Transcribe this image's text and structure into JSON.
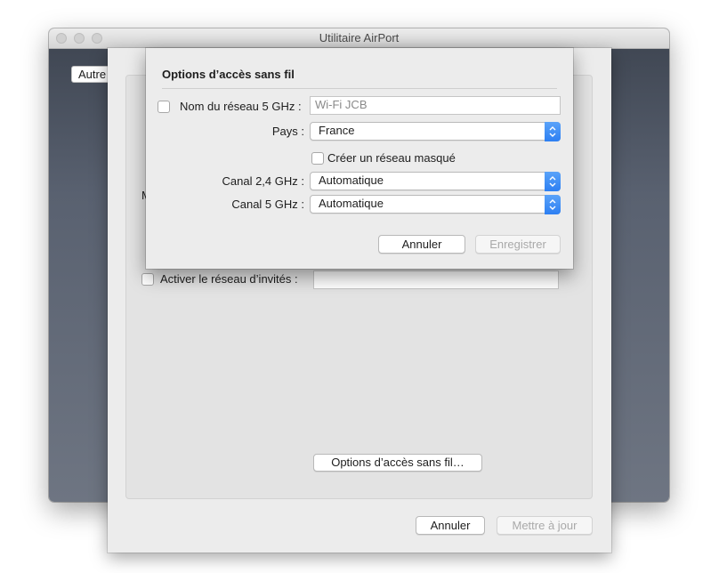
{
  "window": {
    "title": "Utilitaire AirPort",
    "autre_button": "Autre"
  },
  "main_sheet": {
    "partial_label": "M",
    "guest_network_label": "Activer le réseau d’invités :",
    "guest_network_value": "",
    "wireless_options_button": "Options d’accès sans fil…",
    "cancel_button": "Annuler",
    "update_button": "Mettre à jour"
  },
  "options_sheet": {
    "title": "Options d’accès sans fil",
    "network5_label": "Nom du réseau 5 GHz :",
    "network5_value": "Wi-Fi JCB",
    "country_label": "Pays :",
    "country_value": "France",
    "hidden_network_label": "Créer un réseau masqué",
    "channel24_label": "Canal 2,4 GHz :",
    "channel24_value": "Automatique",
    "channel5_label": "Canal 5 GHz :",
    "channel5_value": "Automatique",
    "cancel_button": "Annuler",
    "save_button": "Enregistrer"
  },
  "colors": {
    "accent": "#2d7ff2",
    "sheet_background": "#ececec"
  }
}
